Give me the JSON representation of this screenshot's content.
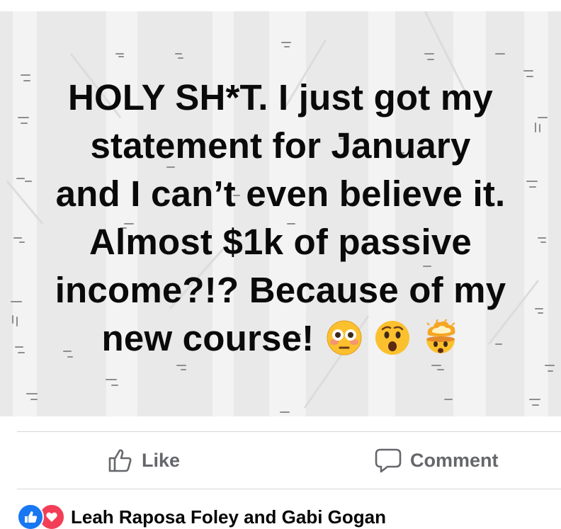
{
  "post": {
    "background_color": "#e9e9e9",
    "text_color": "#0a0a0a",
    "lines": [
      "HOLY SH*T. I just got my",
      "statement for January",
      "and I can’t even believe it.",
      "Almost $1k of passive",
      "income?!? Because of my",
      "new course!"
    ],
    "emojis": [
      "flushed-face-emoji",
      "astonished-face-emoji",
      "exploding-head-emoji"
    ]
  },
  "actions": {
    "like_label": "Like",
    "comment_label": "Comment",
    "color": "#65676b"
  },
  "reactions": {
    "icons": [
      "like-reaction-icon",
      "love-reaction-icon"
    ],
    "like_color": "#1877f2",
    "love_color": "#f33e58",
    "names": "Leah Raposa Foley and Gabi Gogan"
  }
}
